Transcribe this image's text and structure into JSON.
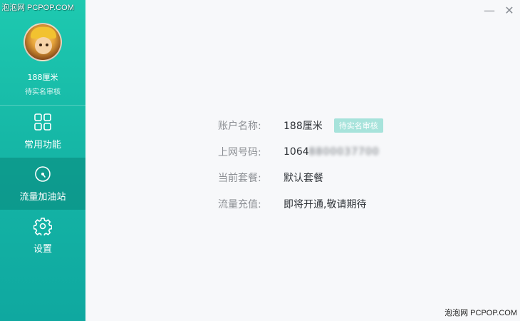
{
  "watermark": {
    "top": "泡泡网 PCPOP.COM",
    "bottom": "泡泡网 PCPOP.COM"
  },
  "window": {
    "minimize_glyph": "—",
    "close_glyph": "✕"
  },
  "sidebar": {
    "user": {
      "name": "188厘米",
      "status": "待实名审核"
    },
    "items": [
      {
        "label": "常用功能",
        "icon": "grid-icon",
        "active": false
      },
      {
        "label": "流量加油站",
        "icon": "gauge-icon",
        "active": true
      },
      {
        "label": "设置",
        "icon": "gear-icon",
        "active": false
      }
    ]
  },
  "account": {
    "name_label": "账户名称:",
    "name_value": "188厘米",
    "badge": "待实名审核",
    "number_label": "上网号码:",
    "number_visible": "1064",
    "number_blurred": "8800037700",
    "plan_label": "当前套餐:",
    "plan_value": "默认套餐",
    "recharge_label": "流量充值:",
    "recharge_value": "即将开通,敬请期待"
  },
  "colors": {
    "accent": "#1ec9b0",
    "badge": "#a7e3db",
    "label": "#8c8f94",
    "text": "#2f3338"
  }
}
